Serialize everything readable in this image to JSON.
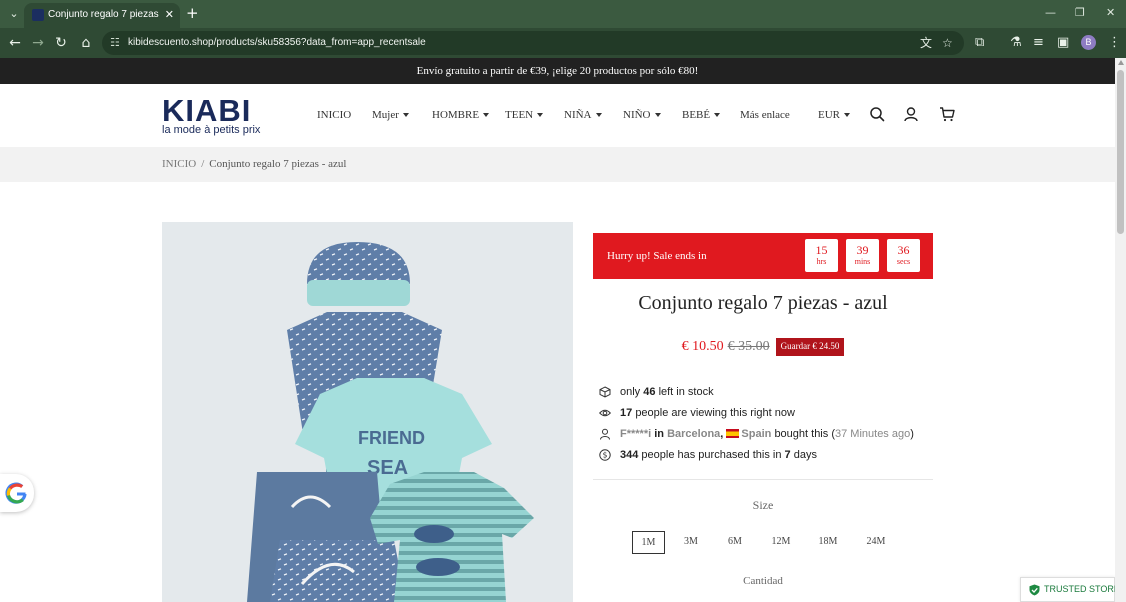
{
  "browser": {
    "tab_title": "Conjunto regalo 7 piezas - azul",
    "url": "kibidescuento.shop/products/sku58356?data_from=app_recentsale",
    "profile_initial": "B"
  },
  "announcement": "Envío gratuito a partir de €39, ¡elige 20 productos por sólo €80!",
  "brand": {
    "name": "KIABI",
    "tagline": "la mode à petits prix"
  },
  "nav": {
    "items": [
      {
        "label": "INICIO",
        "dropdown": false
      },
      {
        "label": "Mujer",
        "dropdown": true
      },
      {
        "label": "HOMBRE",
        "dropdown": true
      },
      {
        "label": "TEEN",
        "dropdown": true
      },
      {
        "label": "NIÑA",
        "dropdown": true
      },
      {
        "label": "NIÑO",
        "dropdown": true
      },
      {
        "label": "BEBÉ",
        "dropdown": true
      },
      {
        "label": "Más enlace",
        "dropdown": false
      }
    ],
    "currency": "EUR"
  },
  "breadcrumb": {
    "home": "INICIO",
    "sep": "/",
    "current": "Conjunto regalo 7 piezas - azul"
  },
  "sale": {
    "text": "Hurry up!  Sale ends in",
    "countdown": [
      {
        "value": "15",
        "unit": "hrs"
      },
      {
        "value": "39",
        "unit": "mins"
      },
      {
        "value": "36",
        "unit": "secs"
      }
    ]
  },
  "product": {
    "title": "Conjunto regalo 7 piezas - azul",
    "price": "€ 10.50",
    "compare_price": "€ 35.00",
    "save_badge": "Guardar € 24.50"
  },
  "stock": {
    "pre": "only",
    "count": "46",
    "post": "left in stock"
  },
  "viewers": {
    "count": "17",
    "post": "people are viewing this right now"
  },
  "recent_buy": {
    "name": "F*****i",
    "in": "in",
    "city": "Barcelona",
    "comma": ",",
    "country": "Spain",
    "mid": "bought this",
    "open": "(",
    "ago": "37 Minutes ago",
    "close": ")"
  },
  "purchased": {
    "count": "344",
    "mid": "people has purchased this in",
    "days": "7",
    "post": "days"
  },
  "size": {
    "label": "Size",
    "options": [
      "1M",
      "3M",
      "6M",
      "12M",
      "18M",
      "24M"
    ],
    "selected": "1M"
  },
  "quantity_label": "Cantidad",
  "trust_badge": "TRUSTED STORE",
  "colors": {
    "sale_red": "#e0191f",
    "save_badge": "#b0141b",
    "brand_navy": "#1a2a5a",
    "chrome_green": "#2f4a34"
  }
}
